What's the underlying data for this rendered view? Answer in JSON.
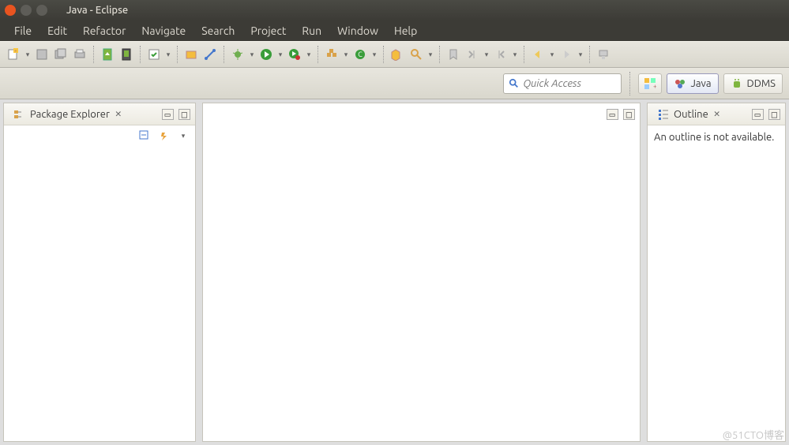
{
  "window": {
    "title": "Java - Eclipse"
  },
  "menu": {
    "items": [
      "File",
      "Edit",
      "Refactor",
      "Navigate",
      "Search",
      "Project",
      "Run",
      "Window",
      "Help"
    ]
  },
  "quickaccess": {
    "placeholder": "Quick Access"
  },
  "perspectives": {
    "java": "Java",
    "ddms": "DDMS"
  },
  "explorer": {
    "title": "Package Explorer"
  },
  "outline": {
    "title": "Outline",
    "message": "An outline is not available."
  },
  "watermark": "@51CTO博客"
}
